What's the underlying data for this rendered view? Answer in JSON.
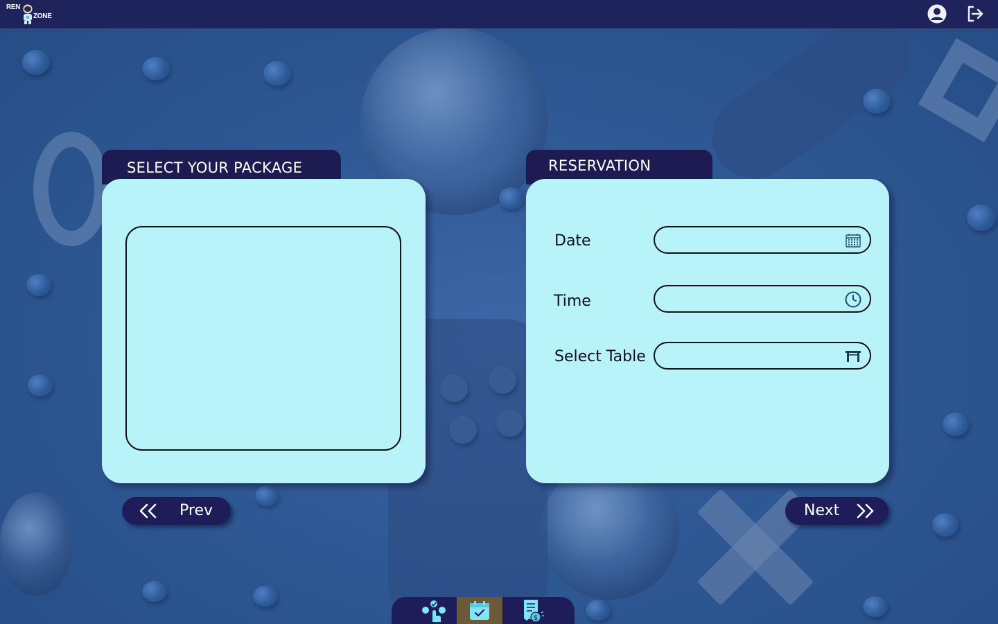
{
  "app": {
    "logo_text_top": "REN",
    "logo_text_bottom": "ZONE"
  },
  "header": {
    "icons": [
      "user-avatar-icon",
      "logout-icon"
    ]
  },
  "package_panel": {
    "title": "SELECT YOUR PACKAGE"
  },
  "reservation_panel": {
    "title": "RESERVATION",
    "fields": [
      {
        "label": "Date",
        "value": "",
        "icon": "calendar-icon"
      },
      {
        "label": "Time",
        "value": "",
        "icon": "clock-icon"
      },
      {
        "label": "Select Table",
        "value": "",
        "icon": "table-icon"
      }
    ]
  },
  "navigation": {
    "prev_label": "Prev",
    "next_label": "Next"
  },
  "dock": {
    "items": [
      {
        "icon": "select-package-icon",
        "active": false
      },
      {
        "icon": "calendar-check-icon",
        "active": true
      },
      {
        "icon": "invoice-payment-icon",
        "active": false
      }
    ]
  },
  "colors": {
    "header_bg": "#1e235c",
    "card_bg": "#b8f3fa",
    "tab_bg": "#1e1a52",
    "dock_active": "#6b5a3a",
    "icon_accent": "#7fe6f5"
  }
}
